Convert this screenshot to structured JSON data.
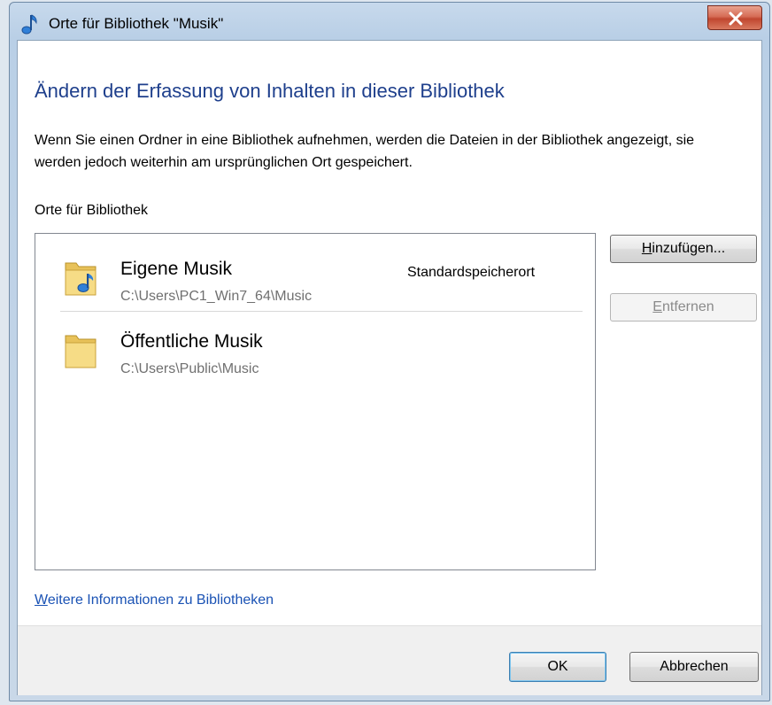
{
  "window": {
    "title": "Orte für Bibliothek \"Musik\"",
    "close_label": "x"
  },
  "dialog": {
    "heading": "Ändern der Erfassung von Inhalten in dieser Bibliothek",
    "description": "Wenn Sie einen Ordner in eine Bibliothek aufnehmen, werden die Dateien in der Bibliothek angezeigt, sie werden jedoch weiterhin am ursprünglichen Ort gespeichert.",
    "section_label": "Orte für Bibliothek",
    "locations": [
      {
        "name": "Eigene Musik",
        "path": "C:\\Users\\PC1_Win7_64\\Music",
        "tag": "Standardspeicherort",
        "icon": "music-folder-icon"
      },
      {
        "name": "Öffentliche Musik",
        "path": "C:\\Users\\Public\\Music",
        "tag": "",
        "icon": "folder-icon"
      }
    ],
    "buttons": {
      "add": {
        "accel": "H",
        "rest": "inzufügen..."
      },
      "remove": {
        "accel": "E",
        "rest": "ntfernen",
        "disabled": true
      },
      "ok": "OK",
      "cancel": "Abbrechen"
    },
    "link": {
      "accel": "W",
      "rest": "eitere Informationen zu Bibliotheken"
    }
  },
  "colors": {
    "heading": "#1e3f8c",
    "link": "#1a52b4",
    "path_text": "#707070",
    "close_button": "#c0462f"
  }
}
